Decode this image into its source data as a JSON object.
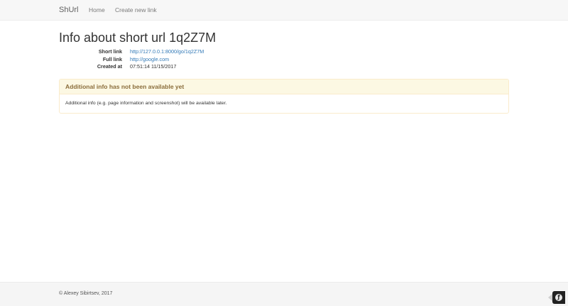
{
  "navbar": {
    "brand": "ShUrl",
    "links": [
      {
        "label": "Home"
      },
      {
        "label": "Create new link"
      }
    ]
  },
  "main": {
    "title": "Info about short url 1q2Z7M",
    "details": [
      {
        "label": "Short link",
        "value": "http://127.0.0.1:8000/go/1q2Z7M",
        "is_link": true
      },
      {
        "label": "Full link",
        "value": "http://google.com",
        "is_link": true
      },
      {
        "label": "Created at",
        "value": "07:51:14 11/15/2017",
        "is_link": false
      }
    ],
    "panel": {
      "heading": "Additional info has not been available yet",
      "body": "Additional info (e.g. page information and screenshot) will be available later."
    }
  },
  "footer": {
    "copyright": "© Alexey Sibirtsev, 2017"
  },
  "debug_toolbar": {
    "icon": "symfony-logo-icon"
  },
  "colors": {
    "link": "#337ab7",
    "warning_bg": "#fcf8e3",
    "warning_border": "#faebcc",
    "warning_text": "#8a6d3b"
  }
}
